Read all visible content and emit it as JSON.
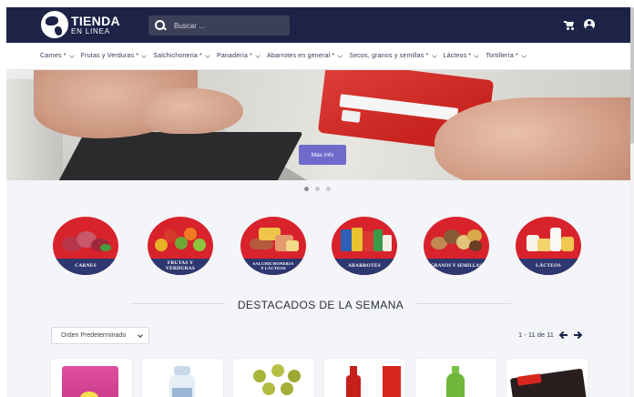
{
  "header": {
    "logo_main": "TIENDA",
    "logo_sub": "EN LINEA",
    "search_placeholder": "Buscar ...",
    "cart_icon": "cart-icon",
    "user_icon": "user-icon"
  },
  "nav": {
    "items": [
      {
        "label": "Carnes"
      },
      {
        "label": "Frutas y Verduras"
      },
      {
        "label": "Salchichoneria"
      },
      {
        "label": "Panadería"
      },
      {
        "label": "Abarrotes en general"
      },
      {
        "label": "Secos, granos y semillas"
      },
      {
        "label": "Lácteos"
      },
      {
        "label": "Tortillería"
      }
    ]
  },
  "hero": {
    "button_label": "Mas info",
    "slides": 3,
    "active_slide": 1
  },
  "categories": [
    {
      "label": "CARNES"
    },
    {
      "label": "FRUTAS Y\nVERDURAS"
    },
    {
      "label": "SALCHICHONERIA\nY LÁCTEOS"
    },
    {
      "label": "ABARROTES"
    },
    {
      "label": "GRANOS Y SEMILLAS"
    },
    {
      "label": "LÁCTEOS"
    }
  ],
  "featured": {
    "title": "DESTACADOS DE LA SEMANA",
    "sort_label": "Orden Predeterminado",
    "pagination": "1 - 11 de 11"
  },
  "colors": {
    "header_bg": "#1c2347",
    "category_red": "#d8232c",
    "category_band": "#2d3870",
    "button_purple": "#6f6acb"
  }
}
